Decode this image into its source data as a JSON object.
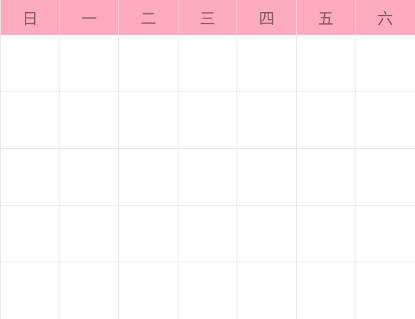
{
  "calendar": {
    "weekdays": [
      "日",
      "一",
      "二",
      "三",
      "四",
      "五",
      "六"
    ],
    "header_color": "#ffabbe",
    "header_text_color": "#7a5560",
    "grid_line_color": "#e6e6e6"
  }
}
